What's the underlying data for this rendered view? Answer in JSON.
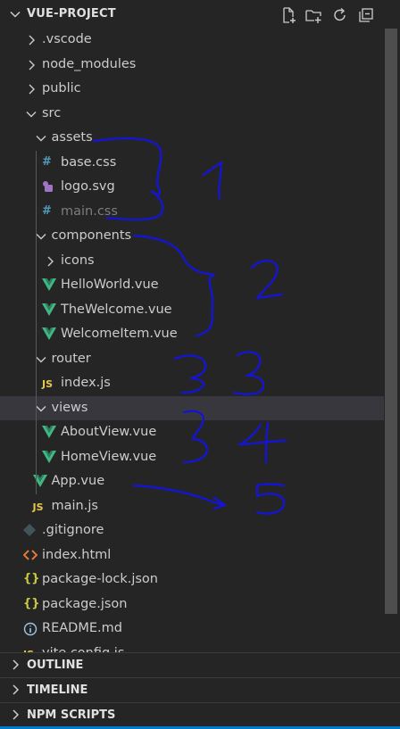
{
  "explorer": {
    "title": "VUE-PROJECT",
    "actions": [
      "new-file-icon",
      "new-folder-icon",
      "refresh-icon",
      "collapse-all-icon"
    ]
  },
  "tree": [
    {
      "label": ".vscode",
      "kind": "folder",
      "expanded": false
    },
    {
      "label": "node_modules",
      "kind": "folder",
      "expanded": false
    },
    {
      "label": "public",
      "kind": "folder",
      "expanded": false
    },
    {
      "label": "src",
      "kind": "folder",
      "expanded": true
    },
    {
      "label": "assets",
      "kind": "folder",
      "expanded": true
    },
    {
      "label": "base.css",
      "kind": "css",
      "glyph": "#"
    },
    {
      "label": "logo.svg",
      "kind": "svg",
      "glyph": "◆"
    },
    {
      "label": "main.css",
      "kind": "css",
      "glyph": "#",
      "dimmed": true
    },
    {
      "label": "components",
      "kind": "folder",
      "expanded": true
    },
    {
      "label": "icons",
      "kind": "folder",
      "expanded": false
    },
    {
      "label": "HelloWorld.vue",
      "kind": "vue",
      "glyph": "V"
    },
    {
      "label": "TheWelcome.vue",
      "kind": "vue",
      "glyph": "V"
    },
    {
      "label": "WelcomeItem.vue",
      "kind": "vue",
      "glyph": "V"
    },
    {
      "label": "router",
      "kind": "folder",
      "expanded": true
    },
    {
      "label": "index.js",
      "kind": "js",
      "glyph": "JS"
    },
    {
      "label": "views",
      "kind": "folder",
      "expanded": true,
      "selected": true
    },
    {
      "label": "AboutView.vue",
      "kind": "vue",
      "glyph": "V"
    },
    {
      "label": "HomeView.vue",
      "kind": "vue",
      "glyph": "V"
    },
    {
      "label": "App.vue",
      "kind": "vue",
      "glyph": "V"
    },
    {
      "label": "main.js",
      "kind": "js",
      "glyph": "JS"
    },
    {
      "label": ".gitignore",
      "kind": "git",
      "glyph": "◆"
    },
    {
      "label": "index.html",
      "kind": "html",
      "glyph": "<>"
    },
    {
      "label": "package-lock.json",
      "kind": "json",
      "glyph": "{}"
    },
    {
      "label": "package.json",
      "kind": "json",
      "glyph": "{}"
    },
    {
      "label": "README.md",
      "kind": "info",
      "glyph": "ⓘ"
    },
    {
      "label": "vite.config.js",
      "kind": "js",
      "glyph": "JS"
    }
  ],
  "panels": [
    {
      "label": "OUTLINE"
    },
    {
      "label": "TIMELINE"
    },
    {
      "label": "NPM SCRIPTS"
    }
  ],
  "annotations": [
    "1",
    "2",
    "3",
    "4",
    "5"
  ],
  "colors": {
    "vue": "#41b883",
    "js": "#e8c74a",
    "css": "#519aba",
    "json": "#cbcb41",
    "html": "#e37933",
    "svg": "#a074c4",
    "git": "#41535b",
    "info": "#519aba",
    "ink": "#1515d0"
  }
}
